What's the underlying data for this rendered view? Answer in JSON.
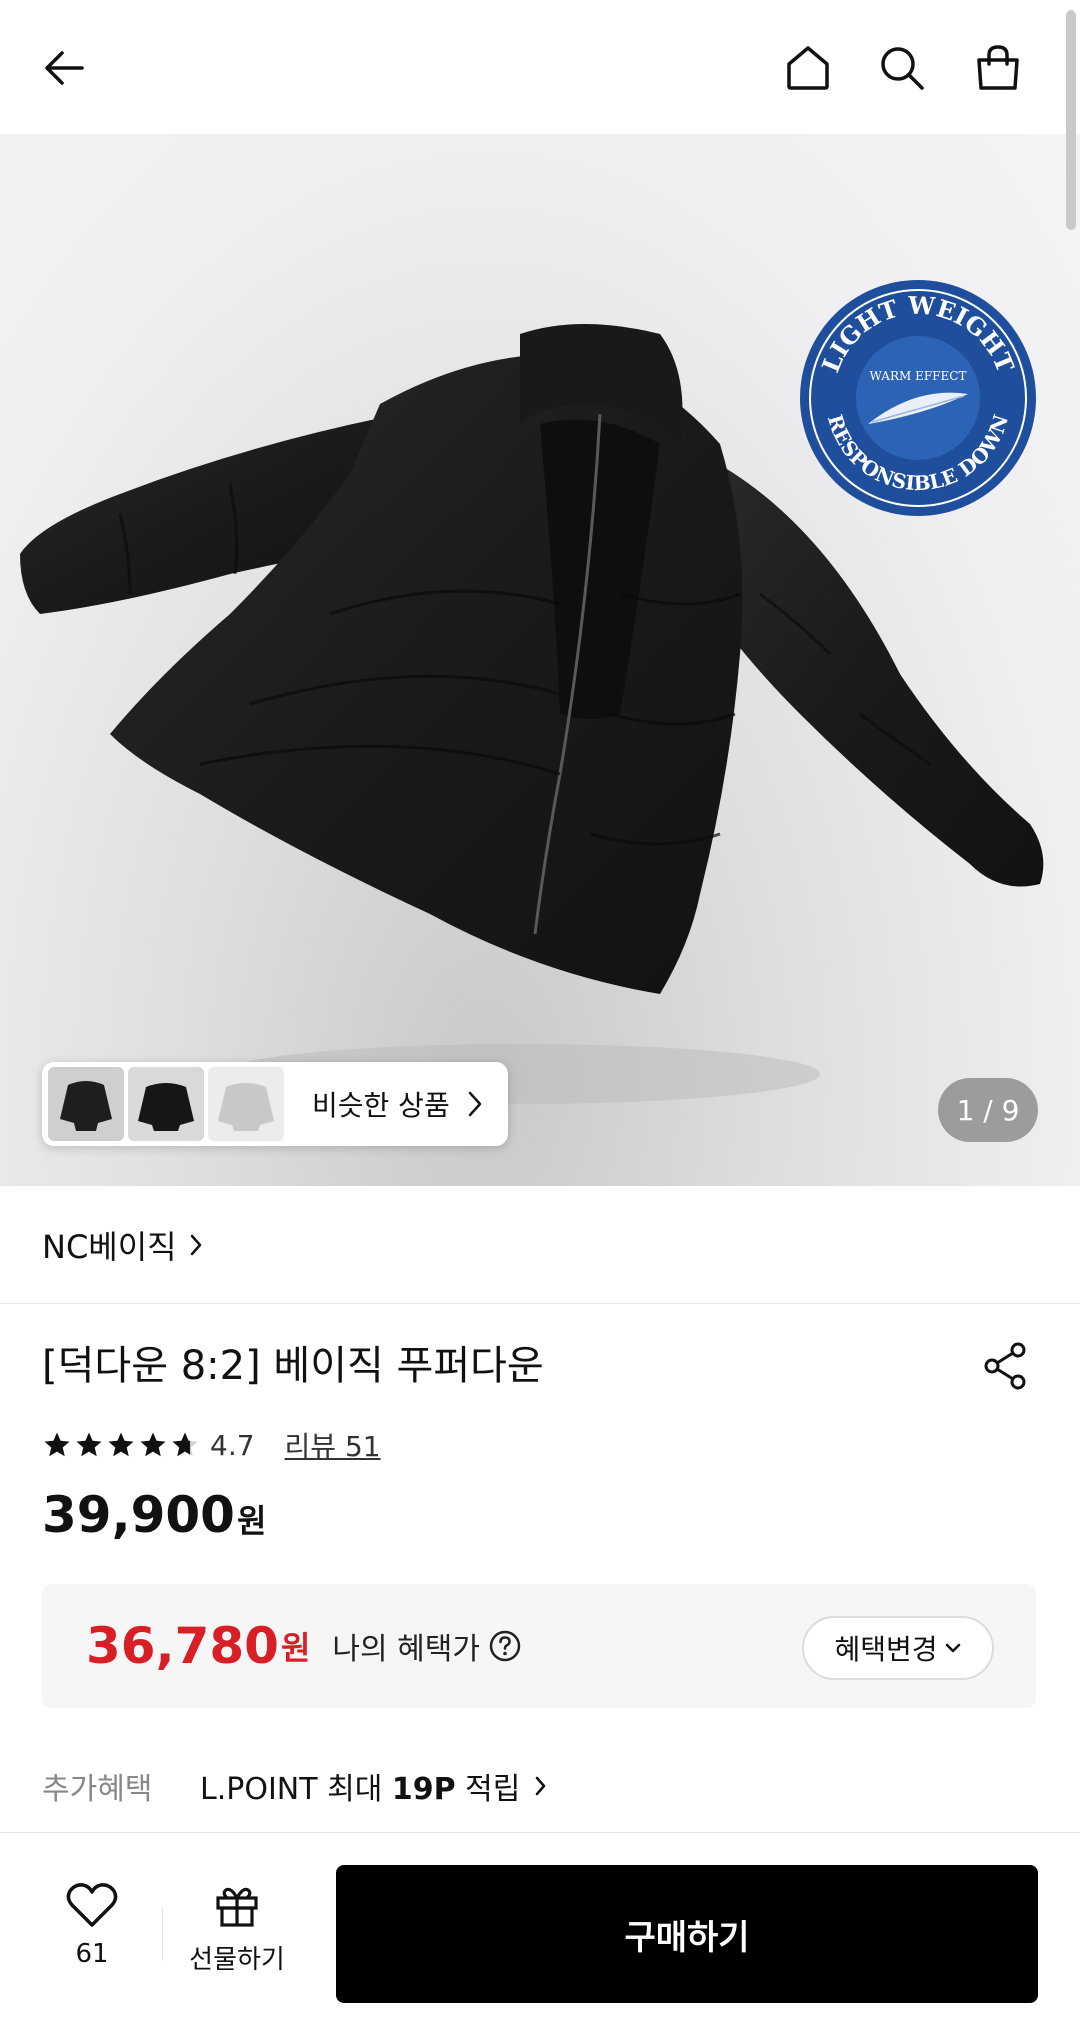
{
  "header": {
    "back_icon": "arrow-left-icon",
    "home_icon": "home-icon",
    "search_icon": "search-icon",
    "cart_icon": "shopping-bag-icon"
  },
  "hero": {
    "badge_top": "LIGHT WEIGHT",
    "badge_mid": "WARM EFFECT",
    "badge_bottom": "RESPONSIBLE DOWN",
    "similar_label": "비슷한 상품",
    "counter": "1 / 9",
    "colors": {
      "badge_blue": "#1f4f9c"
    }
  },
  "product": {
    "brand": "NC베이직",
    "title": "[덕다운 8:2] 베이직 푸퍼다운",
    "rating": "4.7",
    "review_label": "리뷰 51",
    "rating_value": 4.7,
    "price": "39,900",
    "currency": "원"
  },
  "benefit": {
    "price": "36,780",
    "currency": "원",
    "label": "나의 혜택가",
    "change_label": "혜택변경",
    "accent_color": "#d81f26"
  },
  "extra": {
    "label": "추가혜택",
    "text_prefix": "L.POINT 최대 ",
    "text_bold": "19P",
    "text_suffix": " 적립"
  },
  "bottom_bar": {
    "like_count": "61",
    "gift_label": "선물하기",
    "buy_label": "구매하기"
  }
}
